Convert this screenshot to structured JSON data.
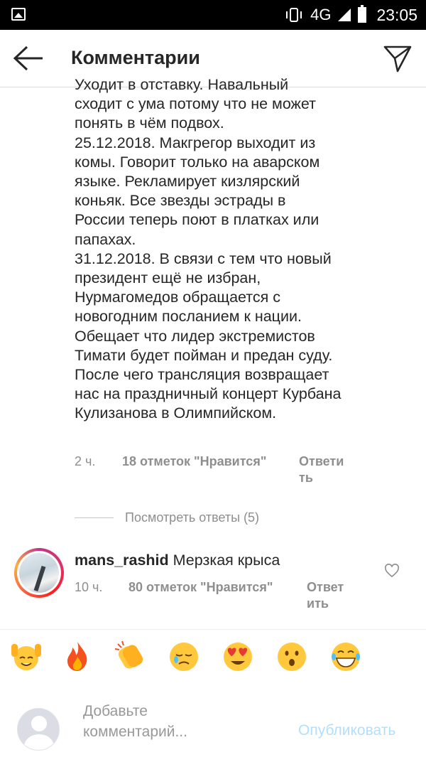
{
  "status_bar": {
    "network": "4G",
    "time": "23:05"
  },
  "header": {
    "title": "Комментарии"
  },
  "comment1": {
    "text_lines": [
      "Уходит в отставку. Навальный",
      "сходит с ума потому что не может",
      "понять в чём подвох.",
      "25.12.2018. Макгрегор выходит из",
      "комы. Говорит только на аварском",
      "языке. Рекламирует кизлярский",
      "коньяк. Все звезды эстрады в",
      "России теперь поют в платках или",
      "папахах.",
      "31.12.2018. В связи с тем что новый",
      "президент ещё не избран,",
      "Нурмагомедов обращается с",
      "новогодним посланием к нации.",
      "Обещает что лидер экстремистов",
      "Тимати будет пойман и предан суду.",
      "После чего трансляция возвращает",
      "нас на праздничный концерт Курбана",
      "Кулизанова в Олимпийском."
    ],
    "time": "2 ч.",
    "likes": "18 отметок \"Нравится\"",
    "reply_line1": "Ответи",
    "reply_line2": "ть"
  },
  "view_replies": "Посмотреть ответы (5)",
  "comment2": {
    "username": "mans_rashid",
    "text": "Мерзкая крыса",
    "time": "10 ч.",
    "likes": "80 отметок \"Нравится\"",
    "reply_line1": "Ответ",
    "reply_line2": "ить"
  },
  "emoji_bar": [
    "raising-hands-emoji",
    "fire-emoji",
    "clapping-hands-emoji",
    "crying-face-emoji",
    "heart-eyes-emoji",
    "surprised-face-emoji",
    "grinning-face-emoji"
  ],
  "composer": {
    "placeholder_line1": "Добавьте",
    "placeholder_line2": "комментарий...",
    "publish_label": "Опубликовать"
  },
  "colors": {
    "accent_disabled": "#b2dffc",
    "muted_text": "#8e8e8e",
    "text": "#262626"
  }
}
